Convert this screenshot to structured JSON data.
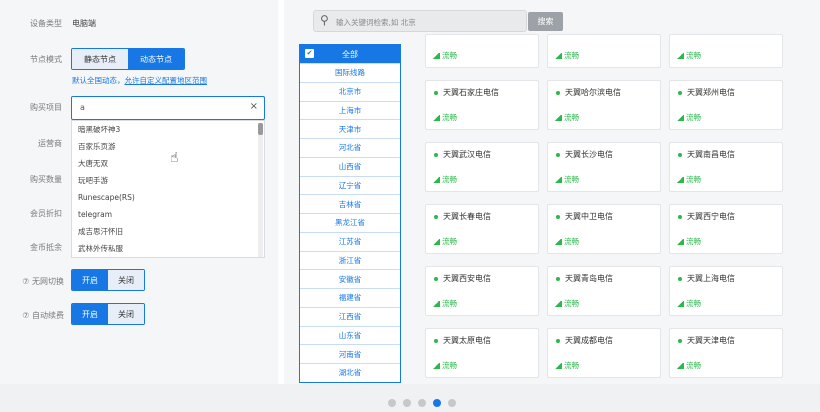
{
  "form": {
    "device_label": "设备类型",
    "device_value": "电脑端",
    "node_mode_label": "节点模式",
    "static_node": "静态节点",
    "dynamic_node": "动态节点",
    "hint_prefix": "默认全国动态，",
    "hint_link": "允许自定义配置地区范围",
    "game_label": "购买项目",
    "game_input": "a",
    "clear_symbol": "×",
    "isp_label": "运营商",
    "qty_label": "购买数量",
    "discount_label": "会员折扣",
    "coin_label": "金币抵余",
    "noupdate_label": "⑦ 无网切换",
    "autorenew_label": "⑦ 自动续费",
    "on_label": "开启",
    "off_label": "关闭",
    "dropdown_options": [
      "暗黑破坏神3",
      "百家乐页游",
      "大唐无双",
      "玩吧手游",
      "Runescape(RS)",
      "telegram",
      "成吉思汗怀旧",
      "武林外传私服"
    ]
  },
  "search": {
    "placeholder": "输入关键词检索,如 北京",
    "button": "搜索"
  },
  "provinces": {
    "header": "全部",
    "items": [
      "国际线路",
      "北京市",
      "上海市",
      "天津市",
      "河北省",
      "山西省",
      "辽宁省",
      "吉林省",
      "黑龙江省",
      "江苏省",
      "浙江省",
      "安徽省",
      "福建省",
      "江西省",
      "山东省",
      "河南省",
      "湖北省"
    ]
  },
  "nodes": {
    "status": "流畅",
    "top_row": [
      "",
      "",
      ""
    ],
    "rows": [
      [
        "天翼石家庄电信",
        "天翼哈尔滨电信",
        "天翼郑州电信"
      ],
      [
        "天翼武汉电信",
        "天翼长沙电信",
        "天翼南昌电信"
      ],
      [
        "天翼长春电信",
        "天翼中卫电信",
        "天翼西宁电信"
      ],
      [
        "天翼西安电信",
        "天翼青岛电信",
        "天翼上海电信"
      ],
      [
        "天翼太原电信",
        "天翼成都电信",
        "天翼天津电信"
      ]
    ]
  },
  "pagination": {
    "count": 5,
    "active": 3
  },
  "colors": {
    "primary": "#1677e5",
    "online": "#2db84d"
  }
}
